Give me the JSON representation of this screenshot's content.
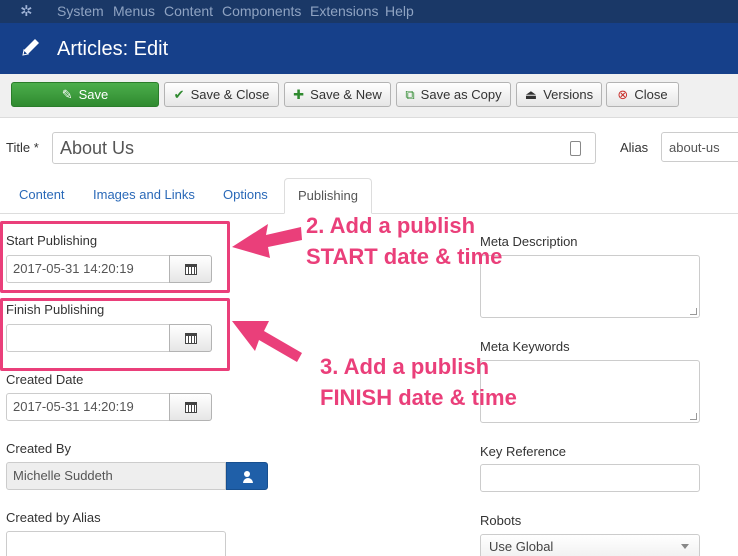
{
  "topmenu": {
    "items": [
      "System",
      "Menus",
      "Content",
      "Components",
      "Extensions",
      "Help"
    ]
  },
  "header": {
    "title": "Articles: Edit"
  },
  "toolbar": {
    "save": "Save",
    "save_close": "Save & Close",
    "save_new": "Save & New",
    "save_copy": "Save as Copy",
    "versions": "Versions",
    "close": "Close"
  },
  "title_field": {
    "label": "Title *",
    "value": "About Us"
  },
  "alias_field": {
    "label": "Alias",
    "value": "about-us"
  },
  "tabs": [
    "Content",
    "Images and Links",
    "Options",
    "Publishing"
  ],
  "active_tab": "Publishing",
  "publishing": {
    "start_label": "Start Publishing",
    "start_value": "2017-05-31 14:20:19",
    "finish_label": "Finish Publishing",
    "finish_value": "",
    "created_label": "Created Date",
    "created_value": "2017-05-31 14:20:19",
    "created_by_label": "Created By",
    "created_by_value": "Michelle Suddeth",
    "created_alias_label": "Created by Alias"
  },
  "metadata": {
    "meta_desc_label": "Meta Description",
    "meta_keywords_label": "Meta Keywords",
    "key_reference_label": "Key Reference",
    "robots_label": "Robots",
    "robots_value": "Use Global"
  },
  "annotations": {
    "step2_line1": "2. Add a publish",
    "step2_line2": "START date & time",
    "step3_line1": "3. Add a publish",
    "step3_line2": "FINISH date & time",
    "color": "#ea3f7a"
  }
}
